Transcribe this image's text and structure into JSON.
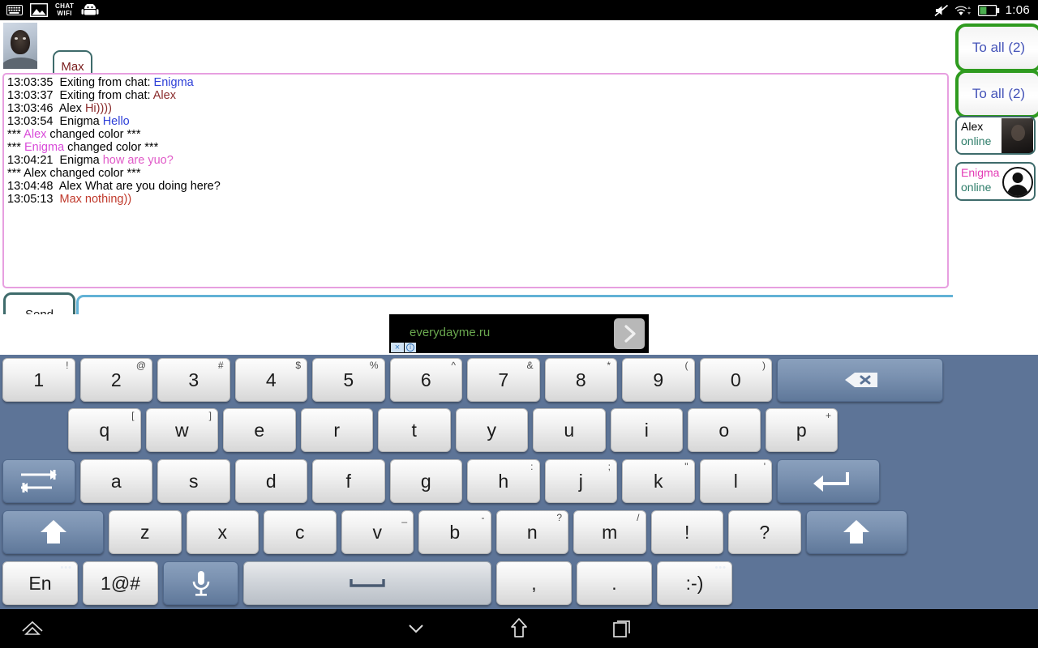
{
  "statusbar": {
    "icons": [
      "keyboard-icon",
      "image-icon",
      "chat-wifi-icon",
      "android-robot-icon"
    ],
    "chat_label": "CHAT",
    "wifi_label": "WIFI",
    "right_icons": [
      "mute-icon",
      "wifi-icon",
      "battery-icon"
    ],
    "clock": "1:06"
  },
  "app": {
    "self_nick": "Max",
    "avatar_name": "self-webcam-avatar",
    "chat_lines": [
      {
        "time": "13:03:35",
        "prefix": "Exiting from chat: ",
        "name": "Enigma",
        "name_color": "#2d3fd8",
        "text": "",
        "text_color": "#000000",
        "type": "system"
      },
      {
        "time": "13:03:37",
        "prefix": "Exiting from chat: ",
        "name": "Alex",
        "name_color": "#8a2b2b",
        "text": "",
        "text_color": "#000000",
        "type": "system"
      },
      {
        "time": "13:03:46",
        "prefix": "",
        "name": "Alex ",
        "name_color": "#000000",
        "text": "Hi))))",
        "text_color": "#8a2b2b",
        "type": "message"
      },
      {
        "time": "13:03:54",
        "prefix": "",
        "name": "Enigma ",
        "name_color": "#000000",
        "text": "Hello",
        "text_color": "#2d3fd8",
        "type": "message"
      },
      {
        "time": "",
        "prefix": "*** ",
        "name": "Alex",
        "name_color": "#d94ad9",
        "text": " changed color ***",
        "text_color": "#000000",
        "type": "event"
      },
      {
        "time": "",
        "prefix": "*** ",
        "name": "Enigma",
        "name_color": "#d94ad9",
        "text": " changed color ***",
        "text_color": "#000000",
        "type": "event"
      },
      {
        "time": "13:04:21",
        "prefix": "",
        "name": "Enigma ",
        "name_color": "#000000",
        "text": "how are yuo?",
        "text_color": "#e05ac8",
        "type": "message"
      },
      {
        "time": "",
        "prefix": "*** ",
        "name": "Alex",
        "name_color": "#000000",
        "text": " changed color ***",
        "text_color": "#000000",
        "type": "event"
      },
      {
        "time": "13:04:48",
        "prefix": "",
        "name": "Alex ",
        "name_color": "#000000",
        "text": "What are you doing here?",
        "text_color": "#000000",
        "type": "message"
      },
      {
        "time": "13:05:13",
        "prefix": "",
        "name": "Max ",
        "name_color": "#c0392b",
        "text": "nothing))",
        "text_color": "#c0392b",
        "type": "message"
      }
    ],
    "send_label": "Send",
    "message_input_value": "",
    "message_input_placeholder": ""
  },
  "right_panel": {
    "to_all_1": "To all (2)",
    "to_all_2": "To all (2)",
    "users": [
      {
        "name": "Alex",
        "status": "online",
        "name_color": "#000000",
        "avatar": "webcam-thumbnail"
      },
      {
        "name": "Enigma",
        "status": "online",
        "name_color": "#e33ab5",
        "avatar": "default-person-avatar"
      }
    ]
  },
  "ad": {
    "text": "everydayme.ru",
    "close_label": "×",
    "info_label": "i",
    "arrow_name": "next-arrow-icon"
  },
  "keyboard": {
    "row1": [
      {
        "label": "1",
        "sup": "!"
      },
      {
        "label": "2",
        "sup": "@"
      },
      {
        "label": "3",
        "sup": "#"
      },
      {
        "label": "4",
        "sup": "$"
      },
      {
        "label": "5",
        "sup": "%"
      },
      {
        "label": "6",
        "sup": "^"
      },
      {
        "label": "7",
        "sup": "&"
      },
      {
        "label": "8",
        "sup": "*"
      },
      {
        "label": "9",
        "sup": "("
      },
      {
        "label": "0",
        "sup": ")"
      },
      {
        "label": "",
        "sup": "",
        "icon": "backspace-icon"
      }
    ],
    "row2": [
      {
        "label": "q",
        "sup": "["
      },
      {
        "label": "w",
        "sup": "]"
      },
      {
        "label": "e",
        "sup": ""
      },
      {
        "label": "r",
        "sup": ""
      },
      {
        "label": "t",
        "sup": ""
      },
      {
        "label": "y",
        "sup": ""
      },
      {
        "label": "u",
        "sup": ""
      },
      {
        "label": "i",
        "sup": ""
      },
      {
        "label": "o",
        "sup": ""
      },
      {
        "label": "p",
        "sup": "+"
      }
    ],
    "row3": [
      {
        "label": "",
        "sup": "",
        "icon": "tab-icon"
      },
      {
        "label": "a",
        "sup": ""
      },
      {
        "label": "s",
        "sup": ""
      },
      {
        "label": "d",
        "sup": ""
      },
      {
        "label": "f",
        "sup": ""
      },
      {
        "label": "g",
        "sup": ""
      },
      {
        "label": "h",
        "sup": ":"
      },
      {
        "label": "j",
        "sup": ";"
      },
      {
        "label": "k",
        "sup": "\""
      },
      {
        "label": "l",
        "sup": "'"
      },
      {
        "label": "",
        "sup": "",
        "icon": "enter-icon"
      }
    ],
    "row4": [
      {
        "label": "",
        "sup": "",
        "icon": "shift-left-icon"
      },
      {
        "label": "z",
        "sup": ""
      },
      {
        "label": "x",
        "sup": ""
      },
      {
        "label": "c",
        "sup": ""
      },
      {
        "label": "v",
        "sup": "_"
      },
      {
        "label": "b",
        "sup": "-"
      },
      {
        "label": "n",
        "sup": "?"
      },
      {
        "label": "m",
        "sup": "/"
      },
      {
        "label": "!",
        "sup": ""
      },
      {
        "label": "?",
        "sup": ""
      },
      {
        "label": "",
        "sup": "",
        "icon": "shift-right-icon"
      }
    ],
    "row5": [
      {
        "label": "En",
        "sup": "",
        "dots": "•••"
      },
      {
        "label": "1@#",
        "sup": ""
      },
      {
        "label": "",
        "sup": "",
        "icon": "microphone-icon"
      },
      {
        "label": "",
        "sup": "",
        "icon": "space-icon"
      },
      {
        "label": ",",
        "sup": ""
      },
      {
        "label": ".",
        "sup": ""
      },
      {
        "label": ":-)",
        "sup": "",
        "dots": "•••"
      }
    ]
  },
  "navbar": {
    "items": [
      "home-outline-icon",
      "hide-keyboard-chevron-icon",
      "home-icon",
      "recent-apps-icon"
    ]
  }
}
